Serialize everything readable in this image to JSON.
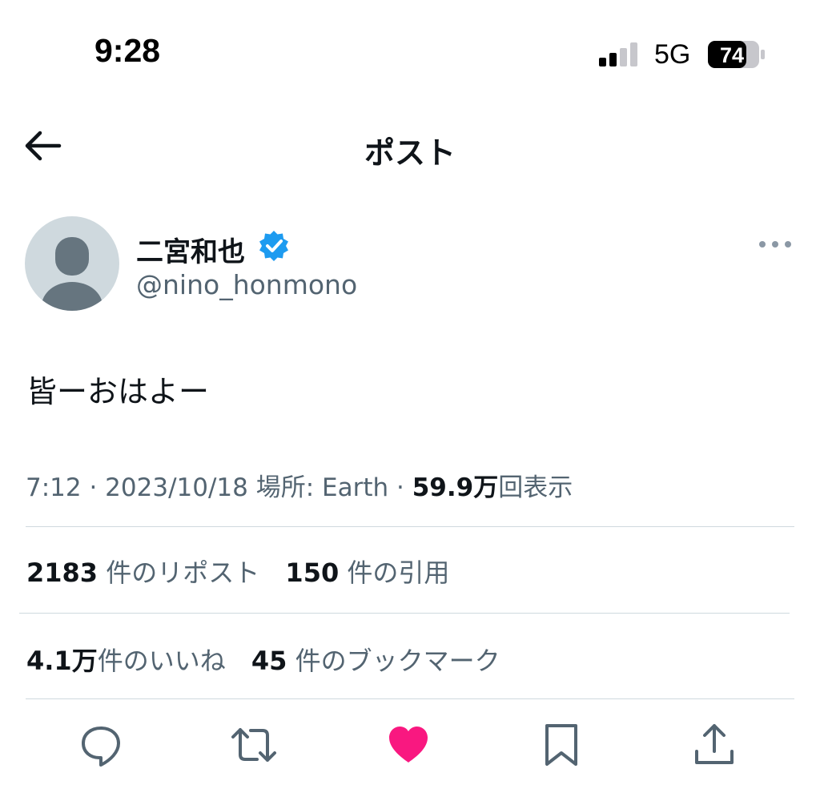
{
  "status_bar": {
    "time": "9:28",
    "network": "5G",
    "battery": "74"
  },
  "header": {
    "title": "ポスト"
  },
  "author": {
    "name": "二宮和也",
    "handle": "@nino_honmono"
  },
  "post": {
    "text": "皆ーおはよー",
    "meta": {
      "time_date": "7:12 · 2023/10/18",
      "location_label": "場所: Earth",
      "separator": "·",
      "views_count": "59.9万",
      "views_label": "回表示"
    }
  },
  "stats": {
    "reposts_count": "2183",
    "reposts_label": "件のリポスト",
    "quotes_count": "150",
    "quotes_label": "件の引用",
    "likes_count": "4.1万",
    "likes_label": "件のいいね",
    "bookmarks_count": "45",
    "bookmarks_label": "件のブックマーク"
  },
  "icons": {
    "back": "arrow-left-icon",
    "verified": "verified-badge-icon",
    "more": "more-dots-icon",
    "reply": "reply-bubble-icon",
    "repost": "repost-icon",
    "like": "heart-icon",
    "bookmark": "bookmark-icon",
    "share": "share-icon"
  },
  "colors": {
    "verified": "#1d9bf0",
    "like_active": "#f91880",
    "secondary_text": "#536471",
    "divider": "#cfd9de"
  }
}
